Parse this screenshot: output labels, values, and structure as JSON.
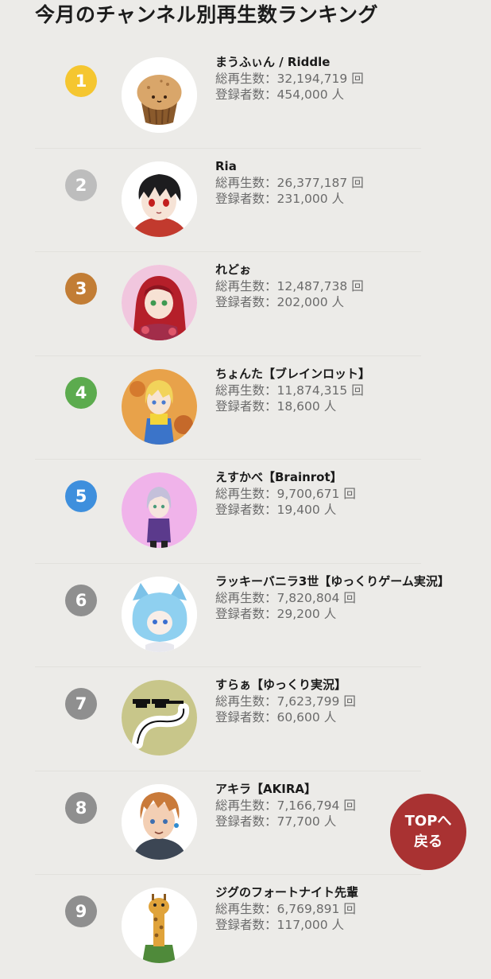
{
  "page": {
    "title": "今月のチャンネル別再生数ランキング"
  },
  "labels": {
    "views_prefix": "総再生数：",
    "views_suffix": " 回",
    "subs_prefix": "登録者数：",
    "subs_suffix": " 人"
  },
  "rankings": [
    {
      "rank": "1",
      "name": "まうふぃん / Riddle",
      "views": "32,194,719",
      "subscribers": "454,000",
      "badge_color": "#f5c630",
      "avatar_icon": "muffin-avatar-icon"
    },
    {
      "rank": "2",
      "name": "Ria",
      "views": "26,377,187",
      "subscribers": "231,000",
      "badge_color": "#bdbdbd",
      "avatar_icon": "dark-haired-boy-avatar-icon"
    },
    {
      "rank": "3",
      "name": "れどぉ",
      "views": "12,487,738",
      "subscribers": "202,000",
      "badge_color": "#c27d35",
      "avatar_icon": "red-haired-girl-avatar-icon"
    },
    {
      "rank": "4",
      "name": "ちょんた【ブレインロット】",
      "views": "11,874,315",
      "subscribers": "18,600",
      "badge_color": "#5cab4e",
      "avatar_icon": "blonde-girl-avatar-icon"
    },
    {
      "rank": "5",
      "name": "えすかべ【Brainrot】",
      "views": "9,700,671",
      "subscribers": "19,400",
      "badge_color": "#3e8fdd",
      "avatar_icon": "purple-hoodie-avatar-icon"
    },
    {
      "rank": "6",
      "name": "ラッキーバニラ3世【ゆっくりゲーム実況】",
      "views": "7,820,804",
      "subscribers": "29,200",
      "badge_color": "#8f8f8f",
      "avatar_icon": "blue-cat-avatar-icon"
    },
    {
      "rank": "7",
      "name": "すらぁ【ゆっくり実況】",
      "views": "7,623,799",
      "subscribers": "60,600",
      "badge_color": "#8f8f8f",
      "avatar_icon": "sunglasses-snake-avatar-icon"
    },
    {
      "rank": "8",
      "name": "アキラ【AKIRA】",
      "views": "7,166,794",
      "subscribers": "77,700",
      "badge_color": "#8f8f8f",
      "avatar_icon": "orange-haired-boy-avatar-icon"
    },
    {
      "rank": "9",
      "name": "ジグのフォートナイト先輩",
      "views": "6,769,891",
      "subscribers": "117,000",
      "badge_color": "#8f8f8f",
      "avatar_icon": "giraffe-avatar-icon"
    }
  ],
  "top_button": {
    "line1": "TOPへ",
    "line2": "戻る"
  }
}
